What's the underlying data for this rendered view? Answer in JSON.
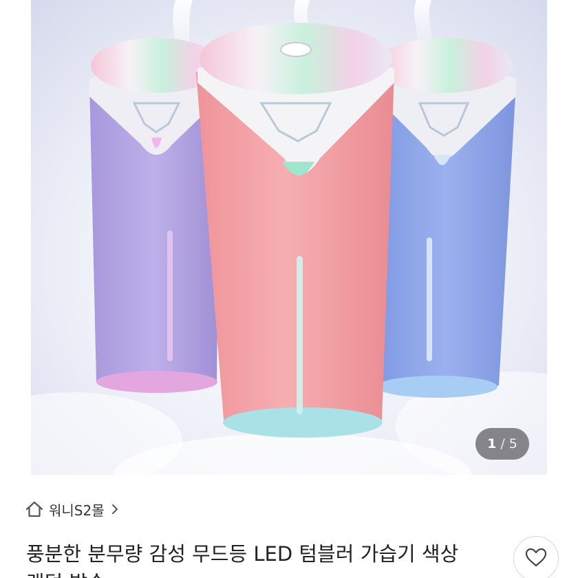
{
  "product": {
    "image_alt": "3가지 색상 LED 텀블러 가습기 (퍼플, 핑크, 블루)",
    "pager": {
      "current": "1",
      "separator": "/",
      "total": "5"
    },
    "colors": {
      "purple": "#b6a8e3",
      "pink": "#f2a2a6",
      "blue": "#8ea6e8"
    }
  },
  "shop": {
    "icon": "home-icon",
    "name": "워니S2몰",
    "chevron_icon": "chevron-right-icon"
  },
  "title": "풍분한 분무량 감성 무드등 LED 텀블러 가습기 색상 랜덤 발송",
  "like": {
    "icon": "heart-outline-icon"
  }
}
